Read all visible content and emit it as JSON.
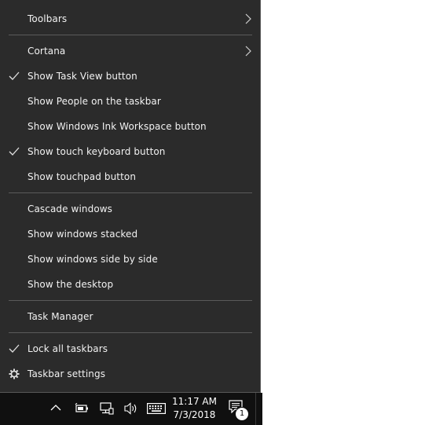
{
  "menu": {
    "toolbars": "Toolbars",
    "cortana": "Cortana",
    "show_task_view": "Show Task View button",
    "show_people": "Show People on the taskbar",
    "show_ink": "Show Windows Ink Workspace button",
    "show_touch_keyboard": "Show touch keyboard button",
    "show_touchpad": "Show touchpad button",
    "cascade": "Cascade windows",
    "stacked": "Show windows stacked",
    "side_by_side": "Show windows side by side",
    "desktop": "Show the desktop",
    "task_manager": "Task Manager",
    "lock": "Lock all taskbars",
    "settings": "Taskbar settings"
  },
  "taskbar": {
    "time": "11:17 AM",
    "date": "7/3/2018",
    "notification_count": "1"
  },
  "colors": {
    "menu_bg": "#2b2b2b",
    "text": "#f2f2f2",
    "taskbar_bg": "#101010"
  },
  "icons": [
    "check-icon",
    "chevron-right-icon",
    "gear-icon",
    "chevron-up-icon",
    "battery-icon",
    "network-icon",
    "speaker-icon",
    "keyboard-icon",
    "notification-icon"
  ]
}
